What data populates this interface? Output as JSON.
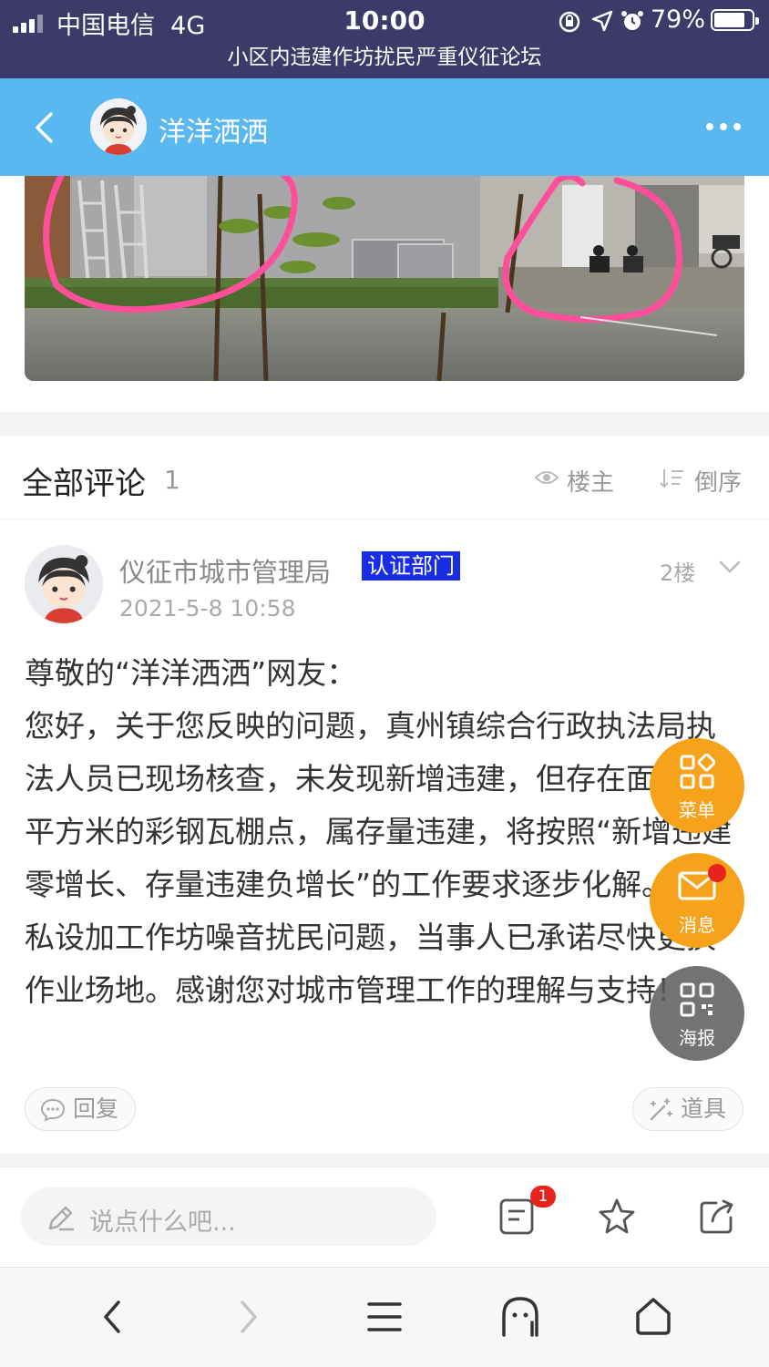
{
  "status_bar": {
    "carrier": "中国电信",
    "network": "4G",
    "time": "10:00",
    "battery": "79%",
    "site_title": "小区内违建作坊扰民严重仪征论坛"
  },
  "topnav": {
    "author_name": "洋洋洒洒",
    "icons": [
      "back-arrow-icon",
      "more-dots-icon"
    ]
  },
  "comments_header": {
    "title": "全部评论",
    "count": "1",
    "op_only_label": "楼主",
    "order_label": "倒序"
  },
  "comment": {
    "author": "仪征市城市管理局",
    "badge": "认证部门",
    "floor": "2楼",
    "time": "2021-5-8 10:58",
    "body": [
      "尊敬的“洋洋洒洒”网友：",
      "您好，关于您反映的问题，真州镇综合行政执法局执法人员已现场核查，未发现新增违建，但存在面积约4平方米的彩钢瓦棚点，属存量违建，将按照“新增违建零增长、存量违建负增长”的工作要求逐步化解。关于私设加工作坊噪音扰民问题，当事人已承诺尽快更换作业场地。感谢您对城市管理工作的理解与支持！"
    ],
    "reply_label": "回复",
    "props_label": "道具"
  },
  "floating_buttons": {
    "menu": "菜单",
    "message": "消息",
    "poster": "海报"
  },
  "reply_bar": {
    "placeholder": "说点什么吧...",
    "comment_badge": "1"
  },
  "colors": {
    "status_bar_bg": "#3b3a68",
    "nav_bg": "#5ab8f0",
    "badge_bg": "#1a2de6",
    "fab_orange": "#f7a21b",
    "notification_red": "#e8231e"
  }
}
